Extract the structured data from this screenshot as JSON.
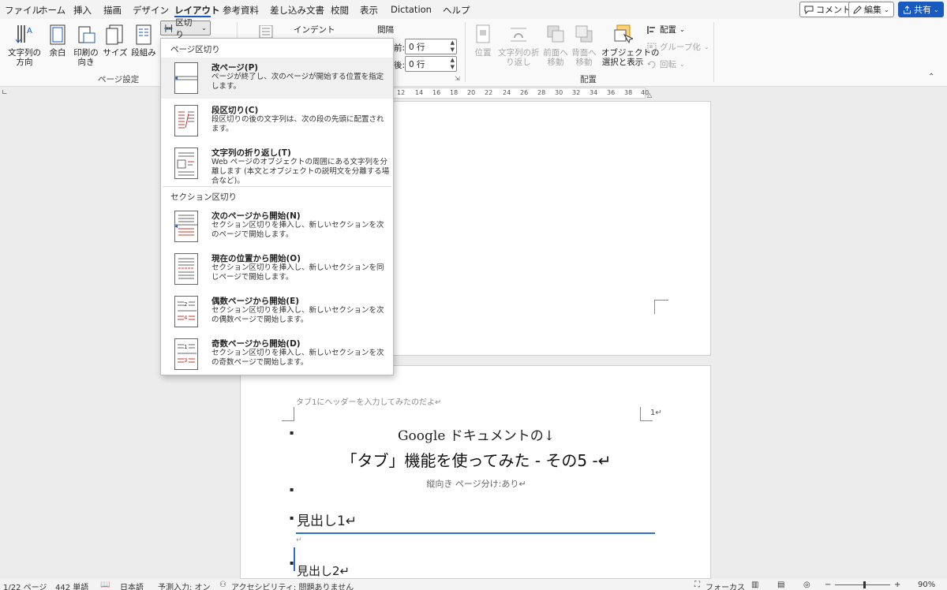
{
  "menu_tabs": [
    "ファイル",
    "ホーム",
    "挿入",
    "描画",
    "デザイン",
    "レイアウト",
    "参考資料",
    "差し込み文書",
    "校閲",
    "表示",
    "Dictation",
    "ヘルプ"
  ],
  "top_buttons": {
    "comment": "コメント",
    "edit": "編集",
    "share": "共有"
  },
  "ribbon": {
    "text_direction": "文字列の\n方向",
    "margins": "余白",
    "orientation": "印刷の\n向き",
    "size": "サイズ",
    "columns": "段組み",
    "breaks": "区切り",
    "page_setup_label": "ページ設定",
    "indent_label": "インデント",
    "spacing_label": "間隔",
    "before_label": "前:",
    "after_label": "後:",
    "before_value": "0 行",
    "after_value": "0 行",
    "position": "位置",
    "wrap_text": "文字列の折\nり返し",
    "bring_forward": "前面へ\n移動",
    "send_backward": "背面へ\n移動",
    "selection_pane": "オブジェクトの\n選択と表示",
    "align": "配置",
    "group": "グループ化",
    "rotate": "回転",
    "arrange_label": "配置"
  },
  "ruler_numbers": [
    "12",
    "14",
    "16",
    "18",
    "20",
    "22",
    "24",
    "26",
    "28",
    "30",
    "32",
    "34",
    "36",
    "38",
    "40"
  ],
  "dropdown": {
    "page_breaks_header": "ページ区切り",
    "section_breaks_header": "セクション区切り",
    "items": [
      {
        "title": "改ページ(P)",
        "desc": "ページが終了し、次のページが開始する位置を指定します。"
      },
      {
        "title": "段区切り(C)",
        "desc": "段区切りの後の文字列は、次の段の先頭に配置されます。"
      },
      {
        "title": "文字列の折り返し(T)",
        "desc": "Web ページのオブジェクトの周囲にある文字列を分離します (本文とオブジェクトの説明文を分離する場合など)。"
      },
      {
        "title": "次のページから開始(N)",
        "desc": "セクション区切りを挿入し、新しいセクションを次のページで開始します。"
      },
      {
        "title": "現在の位置から開始(O)",
        "desc": "セクション区切りを挿入し、新しいセクションを同じページで開始します。"
      },
      {
        "title": "偶数ページから開始(E)",
        "desc": "セクション区切りを挿入し、新しいセクションを次の偶数ページで開始します。"
      },
      {
        "title": "奇数ページから開始(D)",
        "desc": "セクション区切りを挿入し、新しいセクションを次の奇数ページで開始します。"
      }
    ],
    "even_icon_numbers": [
      "2",
      "4"
    ],
    "odd_icon_numbers": [
      "1",
      "3"
    ]
  },
  "document": {
    "header_text": "タブ1にヘッダーを入力してみたのだよ↵",
    "page_number": "1↵",
    "line1": "Google ドキュメントの↓",
    "line2": "「タブ」機能を使ってみた - その5 -↵",
    "line3": "縦向き ページ分け:あり↵",
    "heading1": "見出し1↵",
    "empty_para": "↵",
    "heading2": "見出し2↵",
    "bullet_mark": "▪"
  },
  "status": {
    "page": "1/22 ページ",
    "words": "442 単語",
    "language": "日本語",
    "predictive": "予測入力: オン",
    "accessibility": "アクセシビリティ: 問題ありません",
    "focus": "フォーカス",
    "zoom": "90%"
  },
  "colors": {
    "accent": "#185abd",
    "break_red": "#c0392b",
    "heading_rule": "#2b6fd0"
  }
}
